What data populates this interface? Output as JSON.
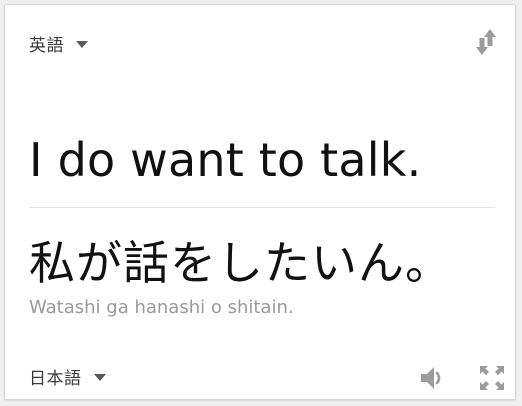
{
  "source": {
    "language": "英語",
    "text": "I do want to talk."
  },
  "target": {
    "language": "日本語",
    "text": "私が話をしたいん。",
    "romanization": "Watashi ga hanashi o shitain."
  },
  "icons": {
    "source_language_dropdown": "chevron-down-icon",
    "swap": "swap-vertical-icon",
    "target_language_dropdown": "chevron-down-icon",
    "speaker": "speaker-icon",
    "expand": "fullscreen-icon"
  },
  "colors": {
    "text_primary": "#111111",
    "text_secondary": "#9a9a9a",
    "icon": "#9c9c9c",
    "divider": "#e4e4e4"
  }
}
